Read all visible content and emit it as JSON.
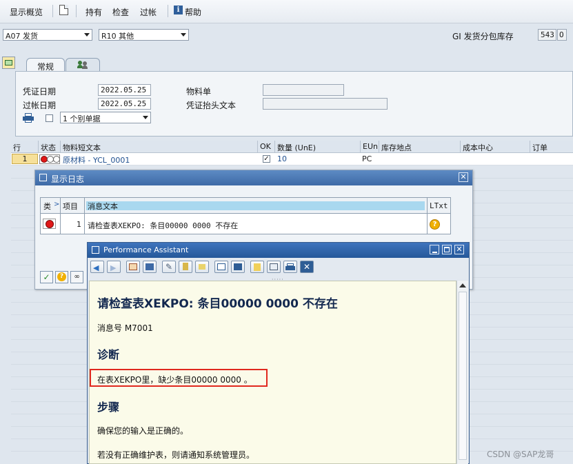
{
  "toolbar": {
    "display_overview": "显示概览",
    "hold": "持有",
    "check": "检查",
    "post": "过帐",
    "help": "帮助"
  },
  "header": {
    "transaction": "A07 发货",
    "reference": "R10 其他",
    "movement_label": "GI 发货分包库存",
    "movement_type": "543",
    "special_stock": "O"
  },
  "tabs": [
    "常规"
  ],
  "general": {
    "doc_date_label": "凭证日期",
    "doc_date": "2022.05.25",
    "post_date_label": "过帐日期",
    "post_date": "2022.05.25",
    "material_slip_label": "物料单",
    "material_slip": "",
    "header_text_label": "凭证抬头文本",
    "header_text": "",
    "print_option": "1 个别单据"
  },
  "grid": {
    "columns": [
      "行",
      "状态",
      "物料短文本",
      "OK",
      "数量 (UnE)",
      "EUn",
      "库存地点",
      "成本中心",
      "订单"
    ],
    "rows": [
      {
        "line": "1",
        "material": "原材料 - YCL_0001",
        "ok": "✓",
        "qty": "10",
        "unit": "PC"
      }
    ]
  },
  "log_dialog": {
    "title": "显示日志",
    "columns": [
      "类",
      "项目",
      "消息文本",
      "LTxt"
    ],
    "rows": [
      {
        "item": "1",
        "text": "请检查表XEKPO: 条目00000 0000  不存在"
      }
    ]
  },
  "performance_assistant": {
    "title": "Performance Assistant",
    "heading": "请检查表XEKPO: 条目00000 0000  不存在",
    "message_no": "消息号  M7001",
    "diagnosis_heading": "诊断",
    "diagnosis_text": "在表XEKPO里，缺少条目00000 0000  。",
    "procedure_heading": "步骤",
    "procedure_text_1": "确保您的输入是正确的。",
    "procedure_text_2": "若没有正确维护表，则请通知系统管理员。"
  },
  "watermark": "CSDN @SAP龙哥",
  "colors": {
    "highlight_box": "#e0281e",
    "title_bar": "#3f74bd",
    "help_heading": "#13284f"
  }
}
